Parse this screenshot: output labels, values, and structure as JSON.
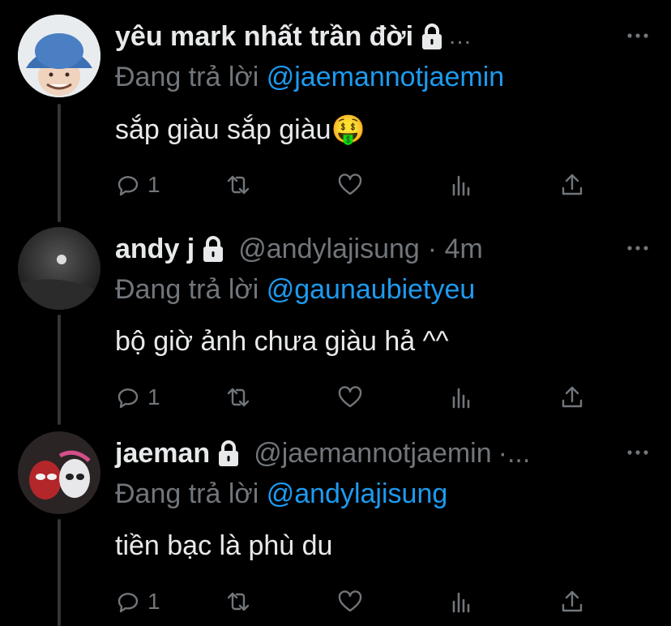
{
  "colors": {
    "background": "#000000",
    "text": "#e7e9ea",
    "muted": "#71767b",
    "link": "#1d9bf0",
    "thread_line": "#333639"
  },
  "tweets": [
    {
      "display_name": "yêu mark nhất trần đời",
      "handle": "",
      "time": "",
      "overflow": "...",
      "reply_prefix": "Đang trả lời",
      "reply_mention": "@jaemannotjaemin",
      "text": "sắp giàu sắp giàu🤑",
      "reply_count": "1",
      "avatar_icon": "avatar-bucket-hat-photo"
    },
    {
      "display_name": "andy j",
      "handle": "@andylajisung",
      "time": "· 4m",
      "overflow": "",
      "reply_prefix": "Đang trả lời",
      "reply_mention": "@gaunaubietyeu",
      "text": "bộ giờ ảnh chưa giàu hả ^^",
      "reply_count": "1",
      "avatar_icon": "avatar-dark-photo"
    },
    {
      "display_name": "jaeman",
      "handle": "@jaemannotjaemin",
      "time": "",
      "overflow": "·...",
      "reply_prefix": "Đang trả lời",
      "reply_mention": "@andylajisung",
      "text": "tiền bạc là phù du",
      "reply_count": "1",
      "avatar_icon": "avatar-spider-people-photo"
    }
  ],
  "icons": [
    "lock-icon",
    "more-icon",
    "reply-icon",
    "retweet-icon",
    "like-icon",
    "views-icon",
    "share-icon"
  ]
}
